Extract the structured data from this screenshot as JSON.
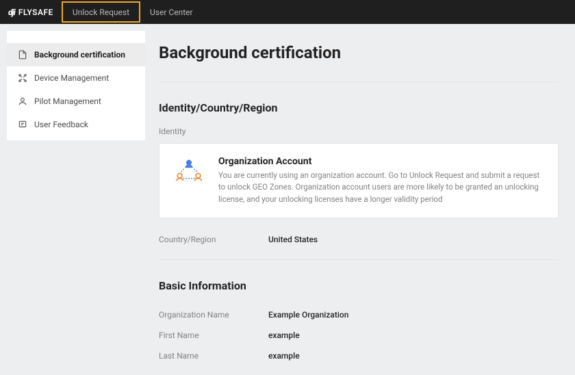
{
  "brand": {
    "prefix": "dji",
    "name": "FLYSAFE"
  },
  "nav": {
    "items": [
      {
        "label": "Unlock Request",
        "highlighted": true
      },
      {
        "label": "User Center",
        "highlighted": false
      }
    ]
  },
  "sidebar": {
    "items": [
      {
        "label": "Background certification"
      },
      {
        "label": "Device Management"
      },
      {
        "label": "Pilot Management"
      },
      {
        "label": "User Feedback"
      }
    ],
    "active_index": 0
  },
  "main": {
    "title": "Background certification",
    "section1": {
      "heading": "Identity/Country/Region",
      "identity_label": "Identity",
      "box": {
        "title": "Organization Account",
        "desc": "You are currently using an organization account. Go to Unlock Request and submit a request to unlock GEO Zones. Organization account users are more likely to be granted an unlocking license, and your unlocking licenses have a longer validity period"
      },
      "country_label": "Country/Region",
      "country_value": "United States"
    },
    "section2": {
      "heading": "Basic Information",
      "fields": [
        {
          "label": "Organization Name",
          "value": "Example Organization"
        },
        {
          "label": "First Name",
          "value": "example"
        },
        {
          "label": "Last Name",
          "value": "example"
        }
      ]
    }
  }
}
